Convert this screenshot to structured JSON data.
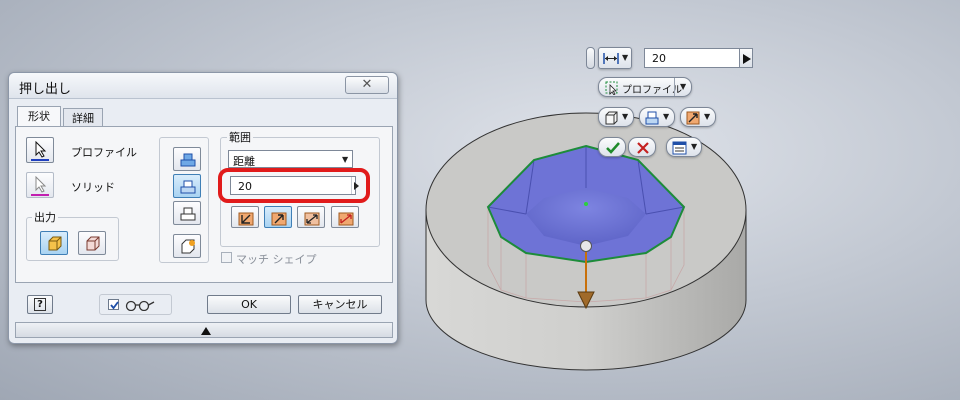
{
  "dialog": {
    "title": "押し出し",
    "close_glyph": "✕",
    "tabs": [
      "形状",
      "詳細"
    ],
    "profile_label": "プロファイル",
    "solid_label": "ソリッド",
    "output_label": "出力",
    "range_label": "範囲",
    "range_value": "距離",
    "distance_value": "20",
    "match_shape_label": "マッチ シェイプ",
    "ok_label": "OK",
    "cancel_label": "キャンセル",
    "help_glyph": "?",
    "preview_checked": true
  },
  "mini_toolbar": {
    "distance_value": "20",
    "profile_label": "プロファイル"
  },
  "colors": {
    "highlight": "#e11b1b",
    "pocket_face": "#6c72d4",
    "ok_check": "#1f8a2a",
    "cancel_x": "#c42020"
  }
}
